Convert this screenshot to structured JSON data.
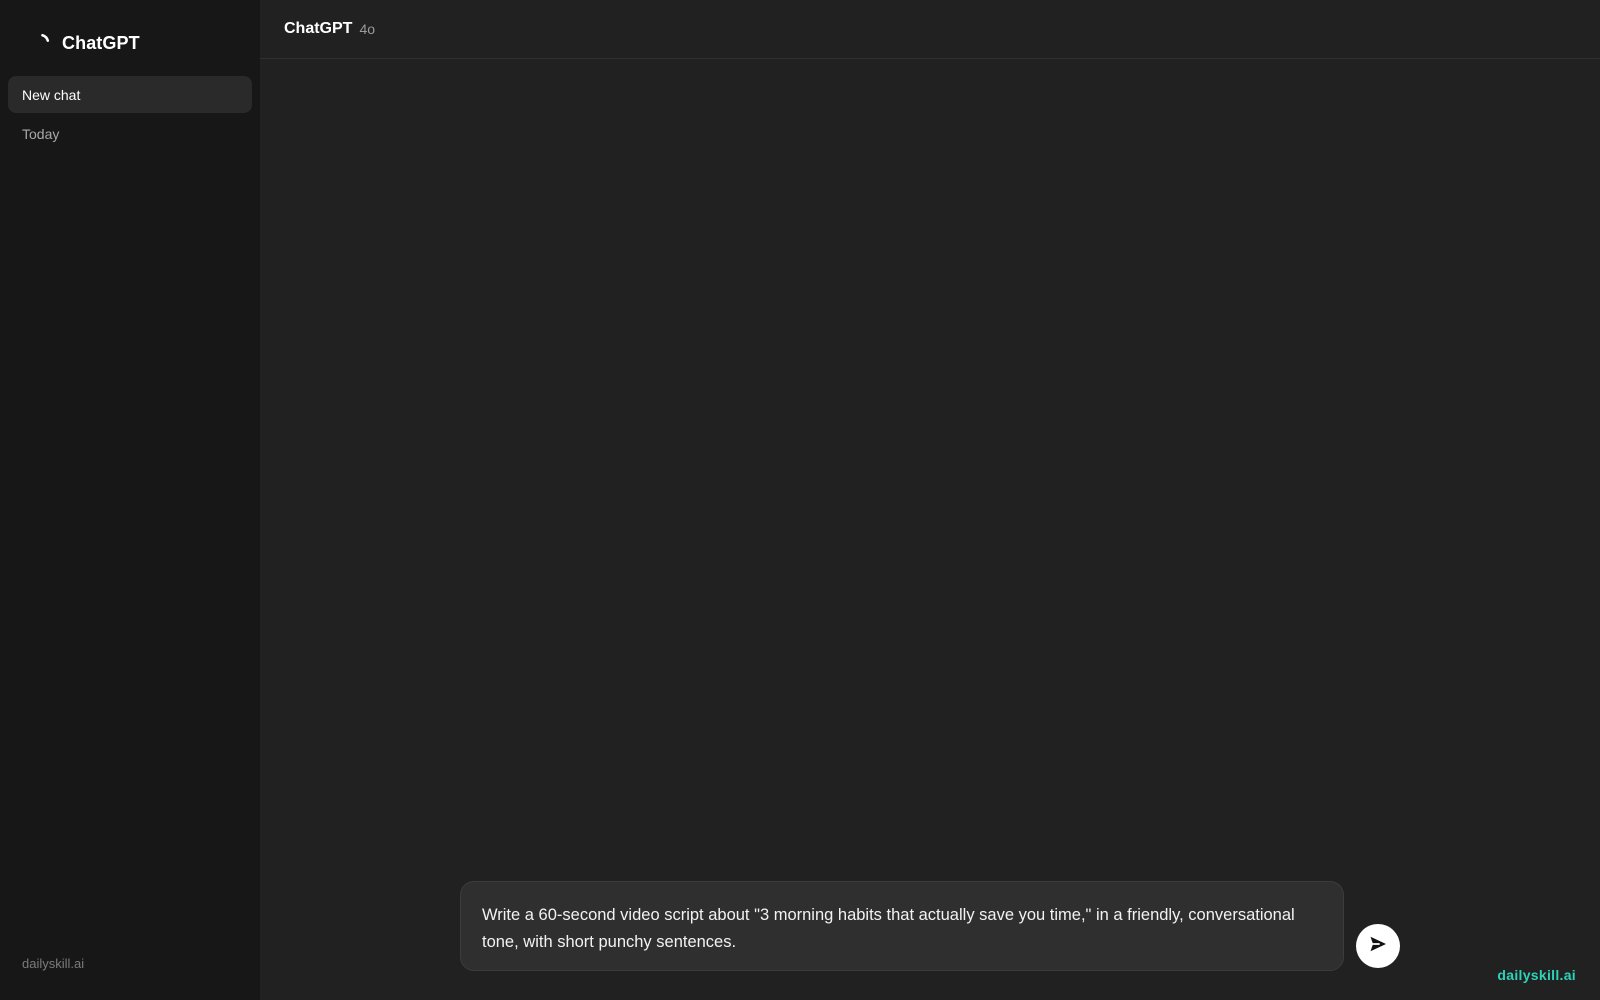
{
  "sidebar": {
    "brand": {
      "name": "ChatGPT",
      "icon": "loading-spinner-icon"
    },
    "new_chat_label": "New chat",
    "section_label": "Today",
    "footer_text": "dailyskill.ai"
  },
  "header": {
    "title": "ChatGPT",
    "model": "4o"
  },
  "composer": {
    "text": "Write a 60-second video script about \"3 morning habits that actually save you time,\" in a friendly, conversational tone, with short punchy sentences.",
    "send_icon": "send-arrow-icon"
  },
  "watermark": "dailyskill.ai",
  "colors": {
    "sidebar_bg": "#171717",
    "main_bg": "#212121",
    "composer_bg": "#2f2f2f",
    "accent": "#2ed3b7",
    "send_button_bg": "#ffffff"
  }
}
